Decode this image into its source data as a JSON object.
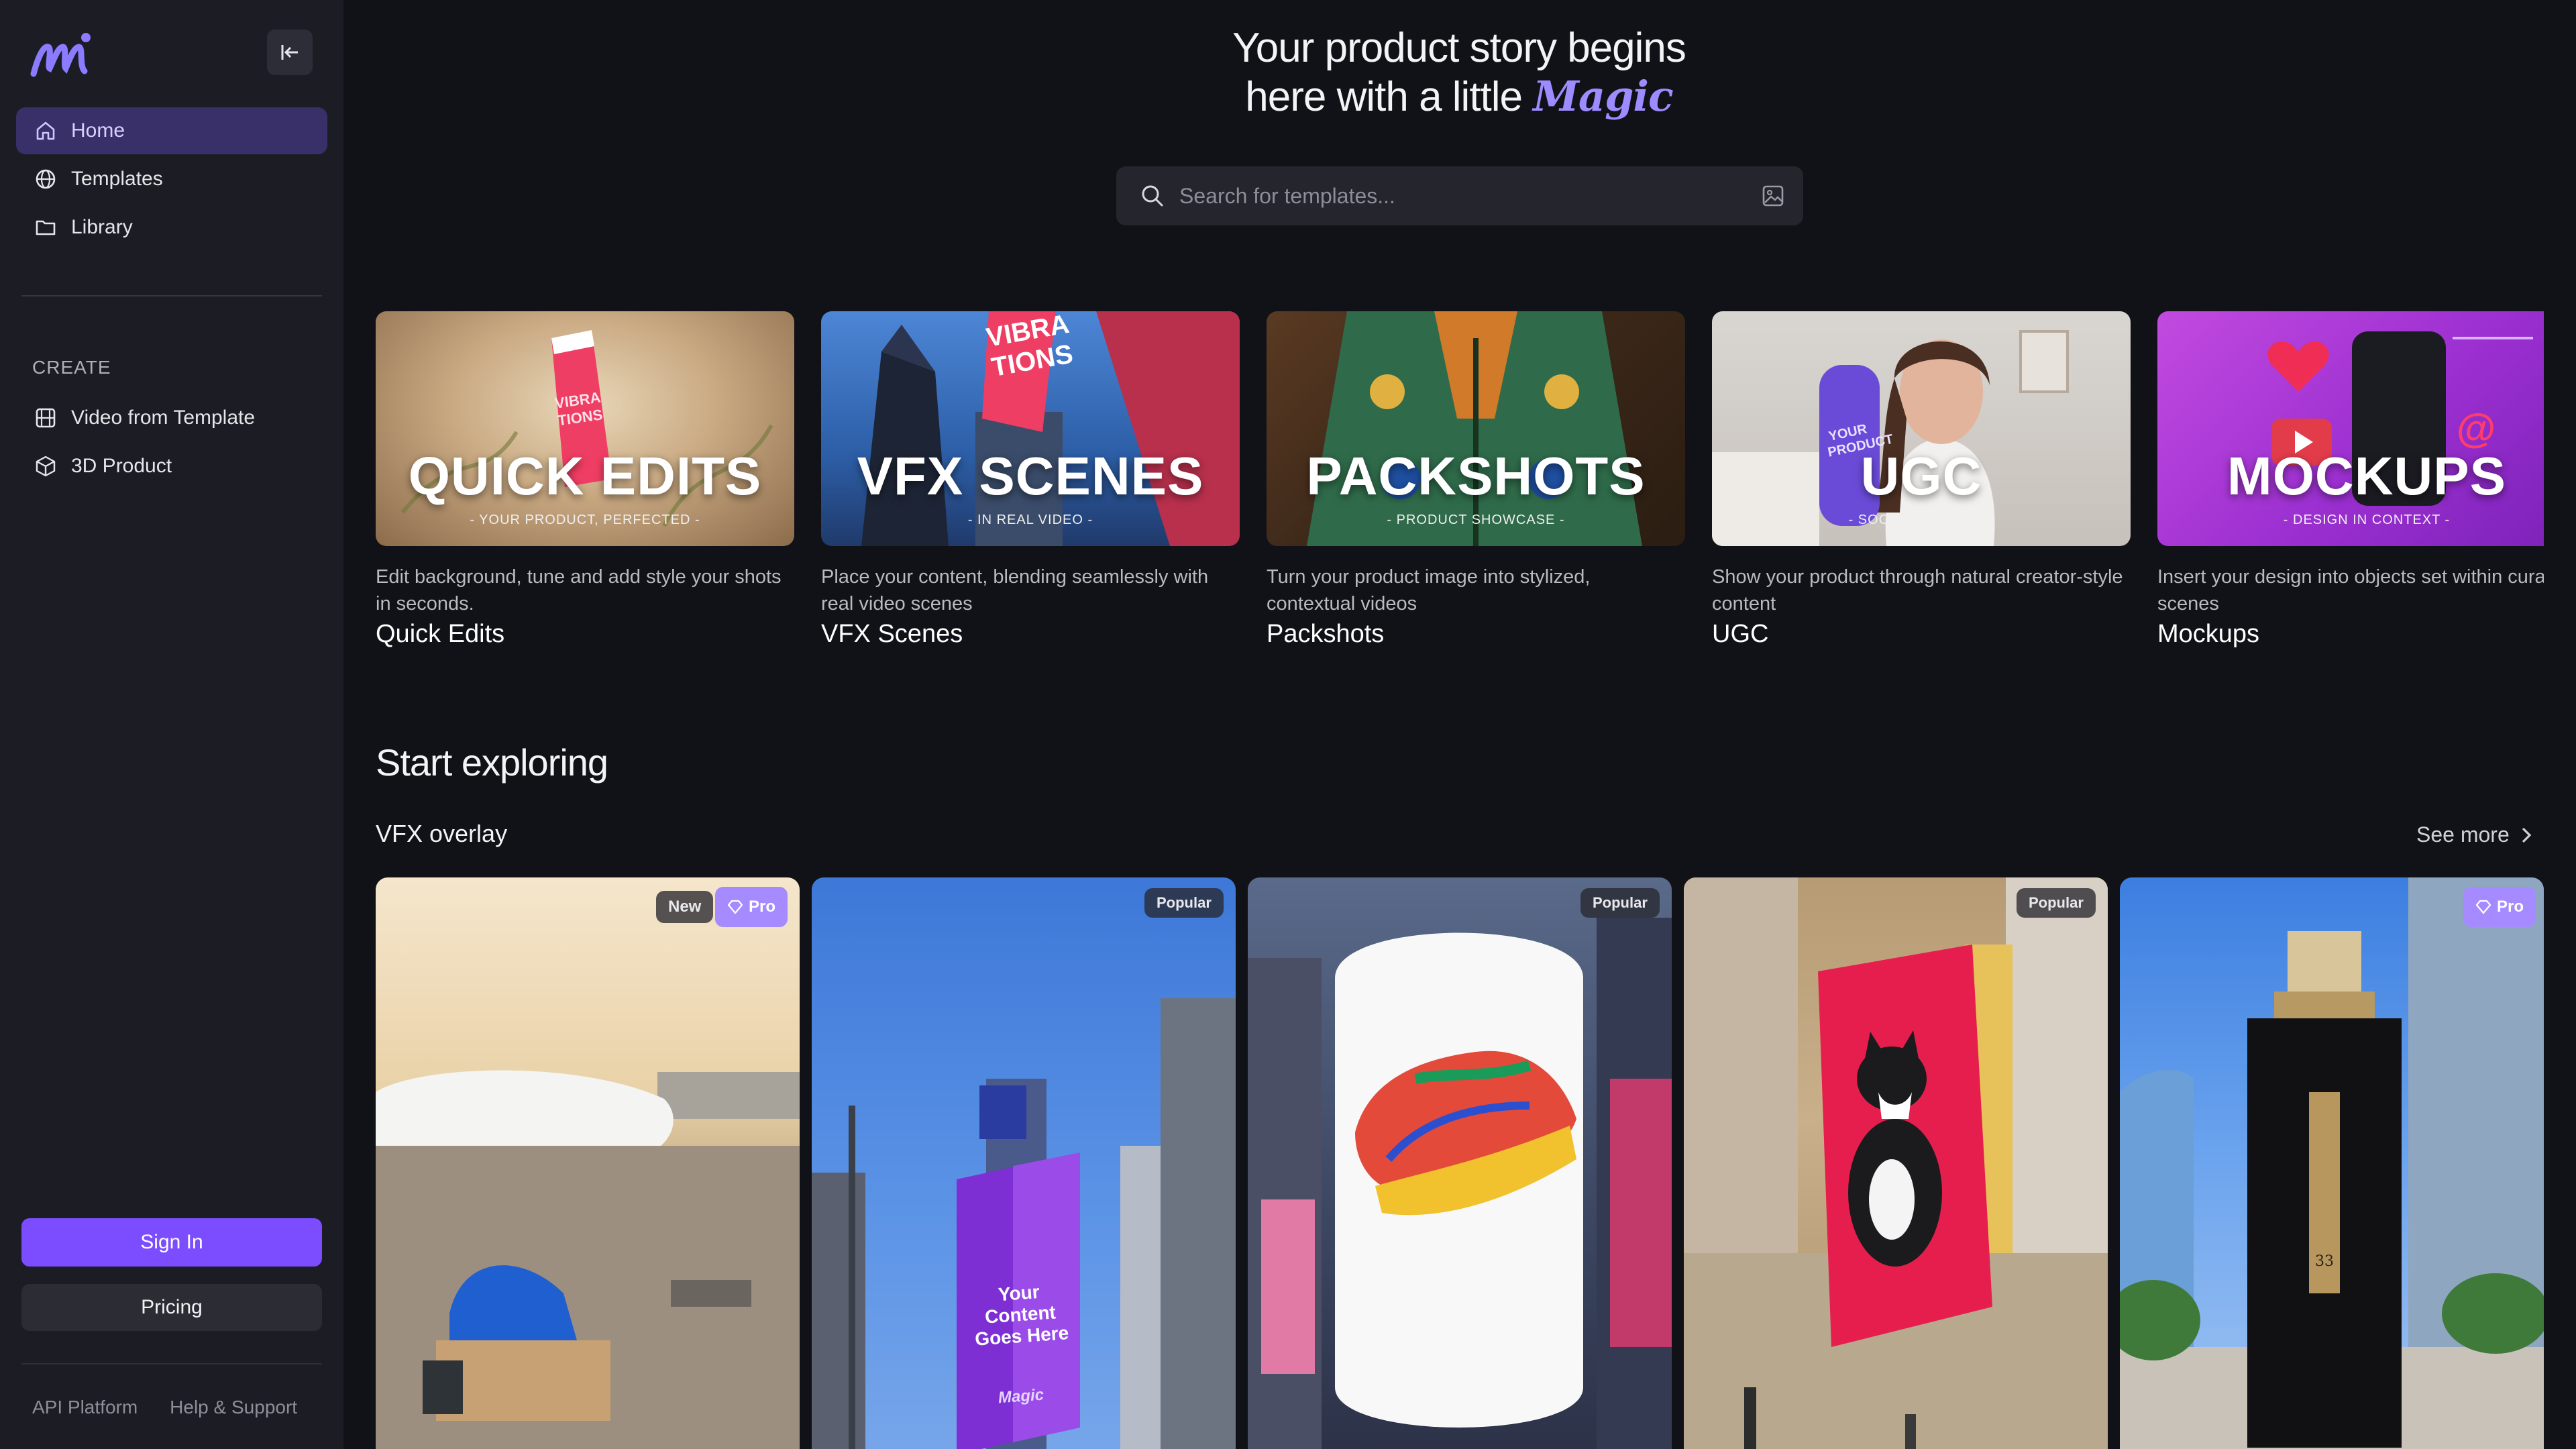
{
  "sidebar": {
    "nav": [
      {
        "label": "Home",
        "icon": "home-icon",
        "active": true
      },
      {
        "label": "Templates",
        "icon": "globe-icon",
        "active": false
      },
      {
        "label": "Library",
        "icon": "folder-icon",
        "active": false
      }
    ],
    "create_label": "CREATE",
    "create_items": [
      {
        "label": "Video from Template",
        "icon": "film-icon"
      },
      {
        "label": "3D Product",
        "icon": "cube-icon"
      }
    ],
    "sign_in": "Sign In",
    "pricing": "Pricing",
    "footer": [
      "API Platform",
      "Help & Support"
    ]
  },
  "hero": {
    "line1": "Your product story begins",
    "line2": "here with a little",
    "magic": "Magic"
  },
  "search": {
    "placeholder": "Search for templates..."
  },
  "categories": [
    {
      "title": "QUICK EDITS",
      "tag": "- YOUR PRODUCT, PERFECTED -",
      "desc": "Edit background, tune and add style your shots in seconds.",
      "name": "Quick Edits",
      "product_text": "VIBRA TIONS"
    },
    {
      "title": "VFX SCENES",
      "tag": "- IN REAL VIDEO -",
      "desc": "Place your content, blending seamlessly with real video scenes",
      "name": "VFX Scenes",
      "product_text": "VIBRA TIONS"
    },
    {
      "title": "PACKSHOTS",
      "tag": "- PRODUCT SHOWCASE -",
      "desc": "Turn your product image into stylized, contextual videos",
      "name": "Packshots"
    },
    {
      "title": "UGC",
      "tag": "- SOCIAL CONTENT -",
      "desc": "Show your product through natural creator-style content",
      "name": "UGC",
      "product_text": "YOUR PRODUCT"
    },
    {
      "title": "MOCKUPS",
      "tag": "- DESIGN IN CONTEXT -",
      "desc": "Insert your design into objects set within curated scenes",
      "name": "Mockups",
      "symbol": "@"
    }
  ],
  "start_exploring": "Start exploring",
  "vfx_row": {
    "title": "VFX overlay",
    "see_more": "See more",
    "cards": [
      {
        "badges": [
          "New",
          "Pro"
        ]
      },
      {
        "badges": [
          "Popular"
        ],
        "overlay_text": "Your Content Goes Here",
        "logo_text": "Magic"
      },
      {
        "badges": [
          "Popular"
        ]
      },
      {
        "badges": [
          "Popular"
        ]
      },
      {
        "badges": [
          "Pro"
        ],
        "bottle_number": "33"
      }
    ]
  },
  "colors": {
    "accent": "#7c4dff",
    "active_nav": "#393069",
    "sidebar": "#1c1d24",
    "background": "#111217"
  }
}
